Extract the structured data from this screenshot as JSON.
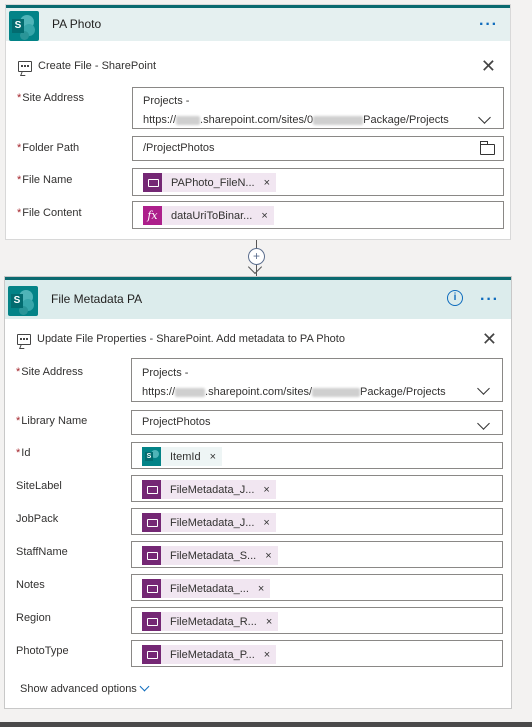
{
  "card1": {
    "title": "PA Photo",
    "action": "Create File - SharePoint",
    "fields": {
      "site_address_label": "Site Address",
      "site_address_line1": "Projects -",
      "site_address_line2_a": "https://",
      "site_address_line2_b": ".sharepoint.com/sites/0",
      "site_address_line2_c": "Package/Projects",
      "folder_path_label": "Folder Path",
      "folder_path_value": "/ProjectPhotos",
      "file_name_label": "File Name",
      "file_name_token": "PAPhoto_FileN...",
      "file_content_label": "File Content",
      "file_content_token": "dataUriToBinar..."
    }
  },
  "connector": {
    "plus": "+"
  },
  "card2": {
    "title": "File Metadata PA",
    "action": "Update File Properties - SharePoint. Add metadata to PA Photo",
    "fields": {
      "site_address_label": "Site Address",
      "site_address_line1": "Projects -",
      "site_address_line2_a": "https://",
      "site_address_line2_b": ".sharepoint.com/sites/",
      "site_address_line2_c": "Package/Projects",
      "library_name_label": "Library Name",
      "library_name_value": "ProjectPhotos",
      "id_label": "Id",
      "id_token": "ItemId",
      "sitelabel_label": "SiteLabel",
      "sitelabel_token": "FileMetadata_J...",
      "jobpack_label": "JobPack",
      "jobpack_token": "FileMetadata_J...",
      "staffname_label": "StaffName",
      "staffname_token": "FileMetadata_S...",
      "notes_label": "Notes",
      "notes_token": "FileMetadata_...",
      "region_label": "Region",
      "region_token": "FileMetadata_R...",
      "phototype_label": "PhotoType",
      "phototype_token": "FileMetadata_P..."
    },
    "advanced": "Show advanced options"
  },
  "symbols": {
    "close": "✕",
    "token_remove": "×",
    "more": "···",
    "info": "i",
    "required": "*",
    "fx": "fx"
  },
  "colors": {
    "sharepoint": "#038387",
    "flow_token": "#742774",
    "expression_token": "#ad1f8b",
    "accent": "#0f6cbd",
    "required": "#a4262c"
  }
}
